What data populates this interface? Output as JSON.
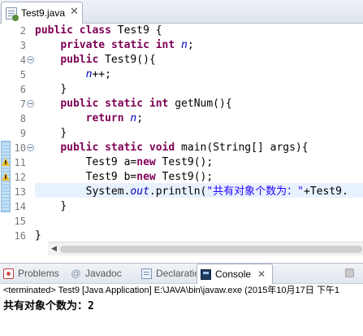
{
  "editor_tab": {
    "title": "Test9.java",
    "close_glyph": "✕",
    "icon": "java-file-icon"
  },
  "editor": {
    "lines": [
      {
        "number": "2"
      },
      {
        "number": "3"
      },
      {
        "number": "4"
      },
      {
        "number": "5"
      },
      {
        "number": "6"
      },
      {
        "number": "7"
      },
      {
        "number": "8"
      },
      {
        "number": "9"
      },
      {
        "number": "10"
      },
      {
        "number": "11"
      },
      {
        "number": "12"
      },
      {
        "number": "13"
      },
      {
        "number": "14"
      },
      {
        "number": "15"
      },
      {
        "number": "16"
      }
    ],
    "code": {
      "l2_kw1": "public",
      "l2_kw2": "class",
      "l2_rest": " Test9 {",
      "l3_kw1": "private",
      "l3_kw2": "static",
      "l3_kw3": "int",
      "l3_fld": "n",
      "l3_rest": ";",
      "l4_kw1": "public",
      "l4_rest": " Test9(){",
      "l5_fld": "n",
      "l5_rest": "++;",
      "l6_rest": "}",
      "l7_kw1": "public",
      "l7_kw2": "static",
      "l7_kw3": "int",
      "l7_rest": " getNum(){",
      "l8_kw1": "return",
      "l8_fld": "n",
      "l8_rest": ";",
      "l9_rest": "}",
      "l10_kw1": "public",
      "l10_kw2": "static",
      "l10_kw3": "void",
      "l10_rest": " main(String[] args){",
      "l11_a": "Test9 a=",
      "l11_kw": "new",
      "l11_b": " Test9();",
      "l12_a": "Test9 b=",
      "l12_kw": "new",
      "l12_b": " Test9();",
      "l13_a": "System.",
      "l13_fld": "out",
      "l13_b": ".println(",
      "l13_str": "\"共有对象个数为：\"",
      "l13_c": "+Test9.",
      "l14_rest": "}",
      "l16_rest": "}"
    },
    "colors": {
      "keyword": "#7f0055",
      "field": "#0000c0",
      "string": "#2a00ff",
      "current_line": "#e8f2fe"
    }
  },
  "views": {
    "tabs": [
      {
        "label": "Problems",
        "icon": "problems-icon"
      },
      {
        "label": "Javadoc",
        "icon": "javadoc-icon"
      },
      {
        "label": "Declaration",
        "icon": "declaration-icon"
      },
      {
        "label": "Console",
        "icon": "console-icon",
        "active": true,
        "close_glyph": "✕"
      }
    ]
  },
  "console": {
    "status": "<terminated> Test9 [Java Application] E:\\JAVA\\bin\\javaw.exe (2015年10月17日 下午1",
    "output": "共有对象个数为：2"
  }
}
